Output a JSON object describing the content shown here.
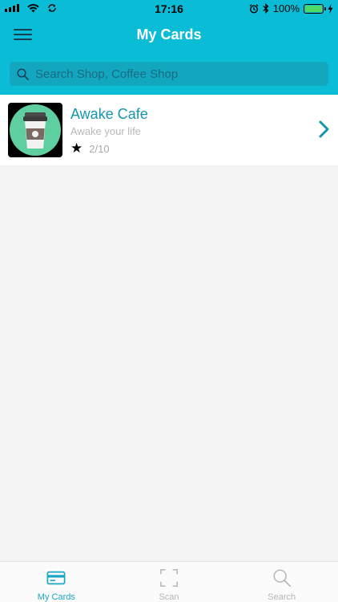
{
  "status_bar": {
    "time": "17:16",
    "battery_percent_label": "100%",
    "battery_level": 1.0
  },
  "header": {
    "title": "My Cards",
    "menu_icon": "hamburger-menu-icon"
  },
  "search": {
    "placeholder": "Search Shop, Coffee Shop",
    "icon": "search-icon"
  },
  "cards": [
    {
      "name": "Awake Cafe",
      "subtitle": "Awake your life",
      "stamps": "2/10",
      "icon": "coffee-cup-icon",
      "thumb_bg": "#5fcfa0"
    }
  ],
  "tabs": [
    {
      "label": "My Cards",
      "icon": "card-icon",
      "active": true
    },
    {
      "label": "Scan",
      "icon": "scan-frame-icon",
      "active": false
    },
    {
      "label": "Search",
      "icon": "search-icon",
      "active": false
    }
  ],
  "colors": {
    "brand": "#0bbcd6",
    "search_field": "#12a6bf",
    "accent_text": "#1596ad",
    "active_tab": "#19a6c4"
  }
}
